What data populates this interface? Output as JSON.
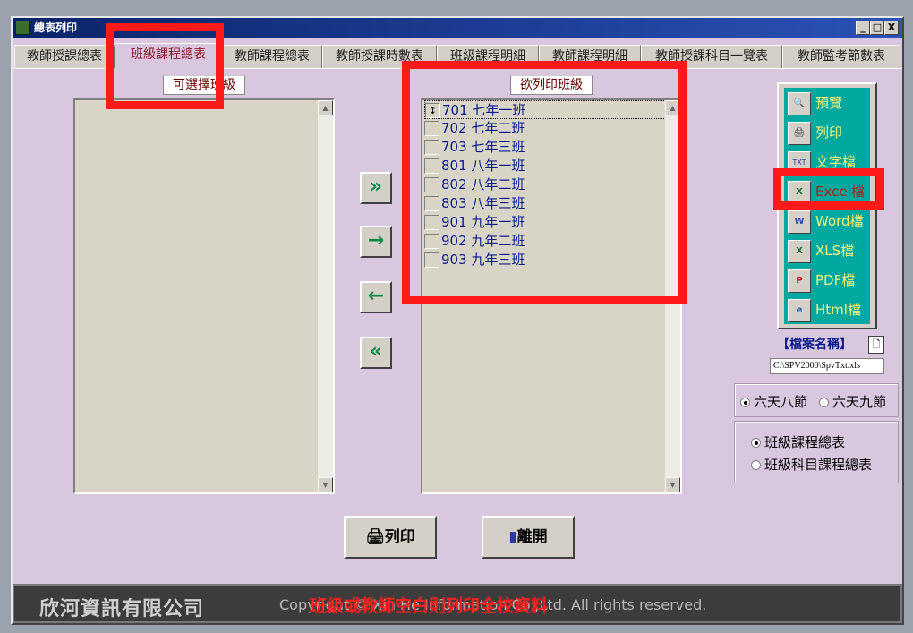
{
  "window": {
    "title": "總表列印",
    "min": "_",
    "max": "□",
    "close": "X"
  },
  "tabs": [
    "教師授課總表",
    "班級課程總表",
    "教師課程總表",
    "教師授課時數表",
    "班級課程明細",
    "教師課程明細",
    "教師授課科目一覽表",
    "教師監考節數表"
  ],
  "left_list": {
    "header": "可選擇班級"
  },
  "right_list": {
    "header": "欲列印班級",
    "items": [
      "701 七年一班",
      "702 七年二班",
      "703 七年三班",
      "801 八年一班",
      "802 八年二班",
      "803 八年三班",
      "901 九年一班",
      "902 九年二班",
      "903 九年三班"
    ]
  },
  "arrows": {
    "all_right": "»",
    "right": "→",
    "left": "←",
    "all_left": "«"
  },
  "output": {
    "items": [
      {
        "label": "預覽",
        "icon": "preview-icon",
        "glyph": "🔍"
      },
      {
        "label": "列印",
        "icon": "printer-icon",
        "glyph": "🖨"
      },
      {
        "label": "文字檔",
        "icon": "txt-file-icon",
        "glyph": "TXT"
      },
      {
        "label": "Excel檔",
        "icon": "excel-icon",
        "glyph": "X"
      },
      {
        "label": "Word檔",
        "icon": "word-icon",
        "glyph": "W"
      },
      {
        "label": "XLS檔",
        "icon": "xls-icon",
        "glyph": "X"
      },
      {
        "label": "PDF檔",
        "icon": "pdf-icon",
        "glyph": "P"
      },
      {
        "label": "Html檔",
        "icon": "html-icon",
        "glyph": "e"
      }
    ]
  },
  "file": {
    "label": "【檔案名稱】",
    "path": "C:\\SPV2000\\SpvTxt.xls"
  },
  "schedule_options": {
    "opt1": "六天八節",
    "opt2": "六天九節"
  },
  "report_options": {
    "opt1": "班級課程總表",
    "opt2": "班級科目課程總表"
  },
  "buttons": {
    "print": "列印",
    "exit": "離開"
  },
  "footer": {
    "company": "欣河資訊有限公司",
    "copyright": "Copyright © Xin He Information Co.,Ltd. All rights reserved.",
    "notice": "班級或教師空白則列印全校資料"
  },
  "colors": {
    "highlight": "#ff1a1a",
    "panel": "#d9c6df",
    "output_bg": "#00a9a0"
  }
}
